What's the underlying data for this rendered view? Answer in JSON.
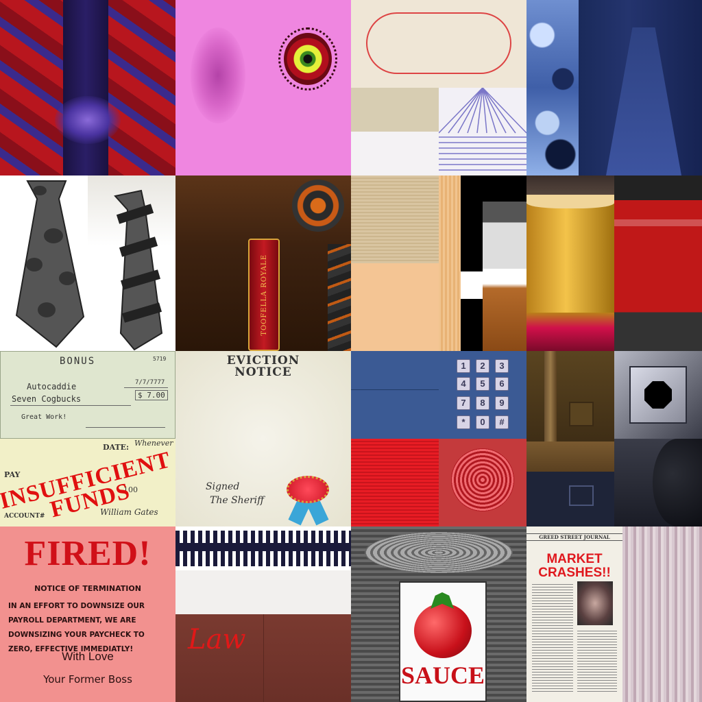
{
  "bonus_check": {
    "title": "BONUS",
    "number": "5719",
    "date": "7/7/7777",
    "payee": "Autocaddie",
    "amount_words": "Seven Cogbucks",
    "amount": "$ 7.00",
    "memo": "Great Work!"
  },
  "eviction_notice": {
    "title_line1": "EVICTION",
    "title_line2": "NOTICE",
    "signed_line1": "Signed",
    "signed_line2": "The Sheriff"
  },
  "insufficient_check": {
    "date_label": "DATE:",
    "date_value": "Whenever",
    "pay_label": "PAY",
    "stamp_line1": "INSUFFICIENT",
    "stamp_line2": "FUNDS",
    "amount_fragment": "100",
    "account_label": "ACCOUNT#",
    "signature": "William Gates"
  },
  "cigar_label": {
    "brand": "TOOFELLA ROYALE"
  },
  "keypad": {
    "keys": [
      "1",
      "2",
      "3",
      "4",
      "5",
      "6",
      "7",
      "8",
      "9",
      "*",
      "0",
      "#"
    ]
  },
  "fired_notice": {
    "title": "FIRED!",
    "subtitle": "NOTICE OF TERMINATION",
    "body": "IN AN EFFORT TO DOWNSIZE OUR PAYROLL DEPARTMENT, WE ARE DOWNSIZING YOUR PAYCHECK TO ZERO, EFFECTIVE IMMEDIATLY!",
    "closing": "With Love",
    "signature": "Your Former Boss"
  },
  "law_book": {
    "word": "Law"
  },
  "sauce_can": {
    "word": "SAUCE"
  },
  "newspaper": {
    "masthead": "GREED STREET JOURNAL",
    "headline_line1": "MARKET",
    "headline_line2": "CRASHES!!"
  },
  "colors": {
    "stamp_red": "#e01010",
    "keypad_blue": "#3b5a94",
    "check_green": "#dfe6cf",
    "fired_pink": "#f2918f"
  }
}
